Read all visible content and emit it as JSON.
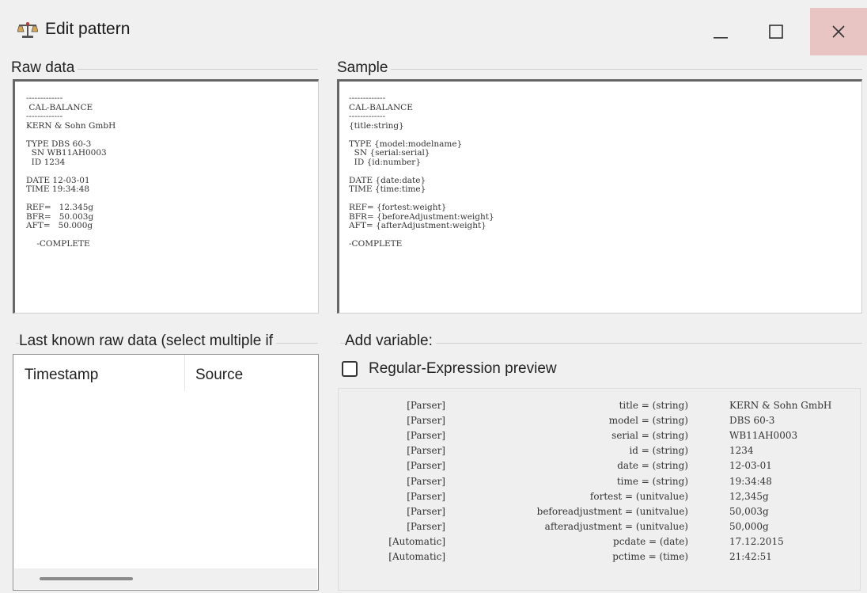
{
  "window": {
    "title": "Edit pattern",
    "icon": "balance-scale-icon",
    "controls": {
      "minimize": "—",
      "maximize": "☐",
      "close": "✕"
    }
  },
  "raw_data": {
    "label": "Raw data",
    "text": "-------------\n CAL-BALANCE\n-------------\nKERN & Sohn GmbH\n\nTYPE DBS 60-3\n  SN WB11AH0003\n  ID 1234\n\nDATE 12-03-01\nTIME 19:34:48\n\nREF=   12.345g\nBFR=   50.003g\nAFT=   50.000g\n\n    -COMPLETE"
  },
  "sample": {
    "label": "Sample",
    "text": "-------------\nCAL-BALANCE\n-------------\n{title:string}\n\nTYPE {model:modelname}\n  SN {serial:serial}\n  ID {id:number}\n\nDATE {date:date}\nTIME {time:time}\n\nREF= {fortest:weight}\nBFR= {beforeAdjustment:weight}\nAFT= {afterAdjustment:weight}\n\n-COMPLETE"
  },
  "last_known": {
    "label": "Last known raw data (select multiple if",
    "columns": [
      "Timestamp",
      "Source"
    ],
    "rows": []
  },
  "add_variable": {
    "label": "Add variable:",
    "regex_preview_label": "Regular-Expression preview",
    "regex_preview_checked": false
  },
  "parser_preview": [
    {
      "source": "[Parser]",
      "name": "title = (string)",
      "value": "KERN & Sohn GmbH"
    },
    {
      "source": "[Parser]",
      "name": "model = (string)",
      "value": "DBS 60-3"
    },
    {
      "source": "[Parser]",
      "name": "serial = (string)",
      "value": "WB11AH0003"
    },
    {
      "source": "[Parser]",
      "name": "id = (string)",
      "value": "1234"
    },
    {
      "source": "[Parser]",
      "name": "date = (string)",
      "value": "12-03-01"
    },
    {
      "source": "[Parser]",
      "name": "time = (string)",
      "value": "19:34:48"
    },
    {
      "source": "[Parser]",
      "name": "fortest = (unitvalue)",
      "value": "12,345g"
    },
    {
      "source": "[Parser]",
      "name": "beforeadjustment = (unitvalue)",
      "value": "50,003g"
    },
    {
      "source": "[Parser]",
      "name": "afteradjustment = (unitvalue)",
      "value": "50,000g"
    },
    {
      "source": "[Automatic]",
      "name": "pcdate = (date)",
      "value": "17.12.2015"
    },
    {
      "source": "[Automatic]",
      "name": "pctime = (time)",
      "value": "21:42:51"
    }
  ]
}
